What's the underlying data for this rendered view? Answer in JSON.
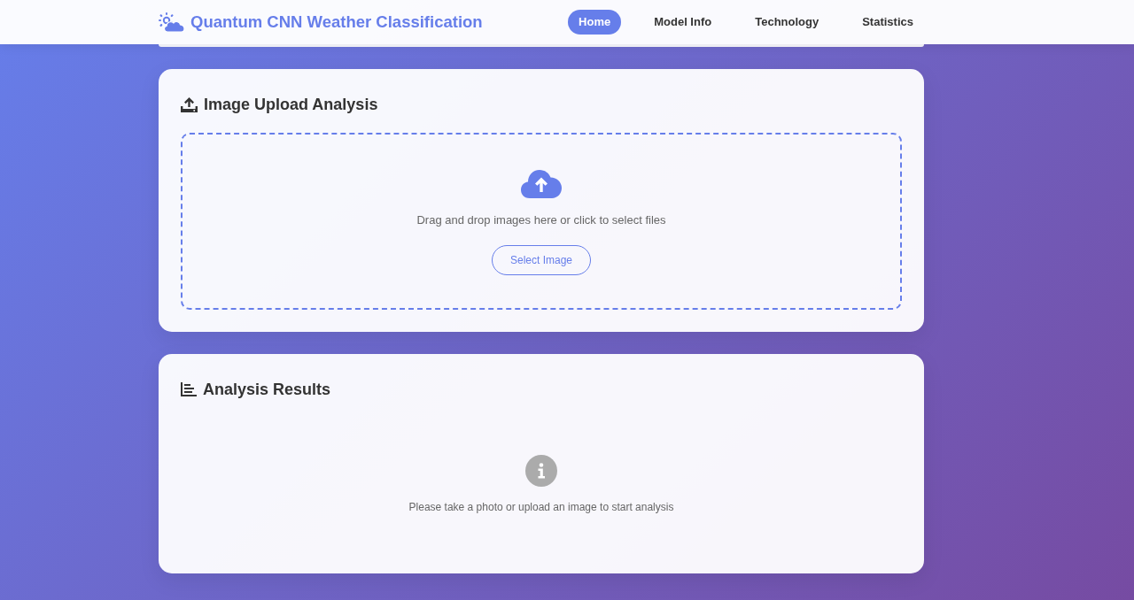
{
  "navbar": {
    "brand": "Quantum CNN Weather Classification",
    "links": [
      {
        "label": "Home",
        "selected": true
      },
      {
        "label": "Model Info",
        "selected": false
      },
      {
        "label": "Technology",
        "selected": false
      },
      {
        "label": "Statistics",
        "selected": false
      }
    ]
  },
  "upload_card": {
    "title": "Image Upload Analysis",
    "dropzone": {
      "hint": "Drag and drop images here or click to select files",
      "button": "Select Image"
    }
  },
  "results_card": {
    "title": "Analysis Results",
    "message": "Please take a photo or upload an image to start analysis"
  }
}
